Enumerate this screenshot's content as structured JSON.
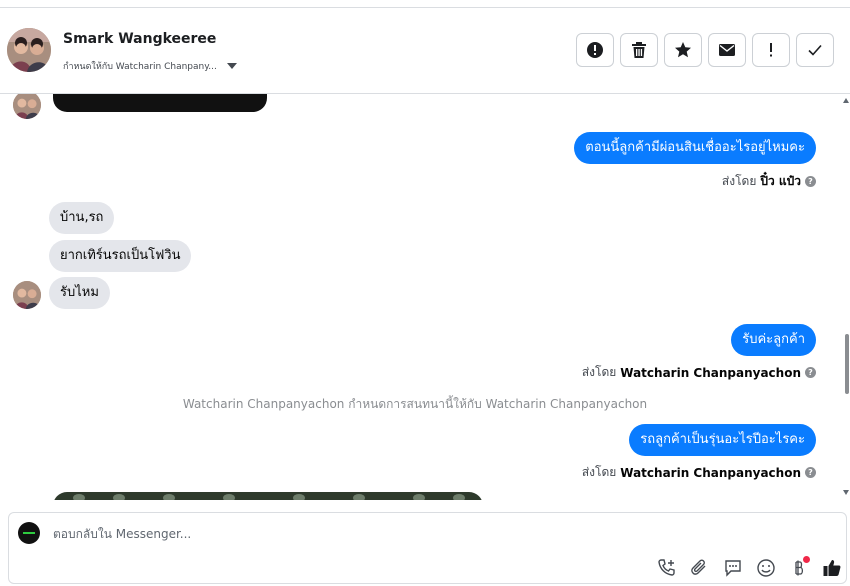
{
  "header": {
    "contact_name": "Smark Wangkeeree",
    "assigned_to": "กำหนดให้กับ Watcharin Chanpany...",
    "actions": [
      {
        "name": "spam-alert-button",
        "icon": "alert-circle-icon"
      },
      {
        "name": "delete-button",
        "icon": "trash-icon"
      },
      {
        "name": "star-button",
        "icon": "star-icon"
      },
      {
        "name": "mark-unread-button",
        "icon": "envelope-icon"
      },
      {
        "name": "follow-up-button",
        "icon": "exclamation-icon"
      },
      {
        "name": "mark-done-button",
        "icon": "check-icon"
      }
    ]
  },
  "messages": [
    {
      "direction": "out",
      "text": "ตอนนี้ลูกค้ามีผ่อนสินเชื่ออะไรอยู่ไหมคะ",
      "sent_by_prefix": "ส่งโดย",
      "sent_by_name": "ปิ๋ว แป๋ว"
    },
    {
      "direction": "in",
      "text": "บ้าน,รถ"
    },
    {
      "direction": "in",
      "text": "ยากเทิร์นรถเป็นโฟวิน"
    },
    {
      "direction": "in",
      "text": "รับไหม"
    },
    {
      "direction": "out",
      "text": "รับค่ะลูกค้า",
      "sent_by_prefix": "ส่งโดย",
      "sent_by_name": "Watcharin Chanpanyachon"
    },
    {
      "direction": "system",
      "text": "Watcharin Chanpanyachon กำหนดการสนทนานี้ให้กับ Watcharin Chanpanyachon"
    },
    {
      "direction": "out",
      "text": "รถลูกค้าเป็นรุ่นอะไรปีอะไรคะ",
      "sent_by_prefix": "ส่งโดย",
      "sent_by_name": "Watcharin Chanpanyachon"
    }
  ],
  "composer": {
    "placeholder": "ตอบกลับใน Messenger...",
    "tools": [
      "call-add-icon",
      "paperclip-icon",
      "saved-reply-icon",
      "emoji-icon",
      "baht-payment-icon",
      "thumbs-up-icon"
    ]
  },
  "colors": {
    "outgoing_bubble": "#0a7cff",
    "incoming_bubble": "#e4e6eb",
    "notification_dot": "#f02849"
  }
}
